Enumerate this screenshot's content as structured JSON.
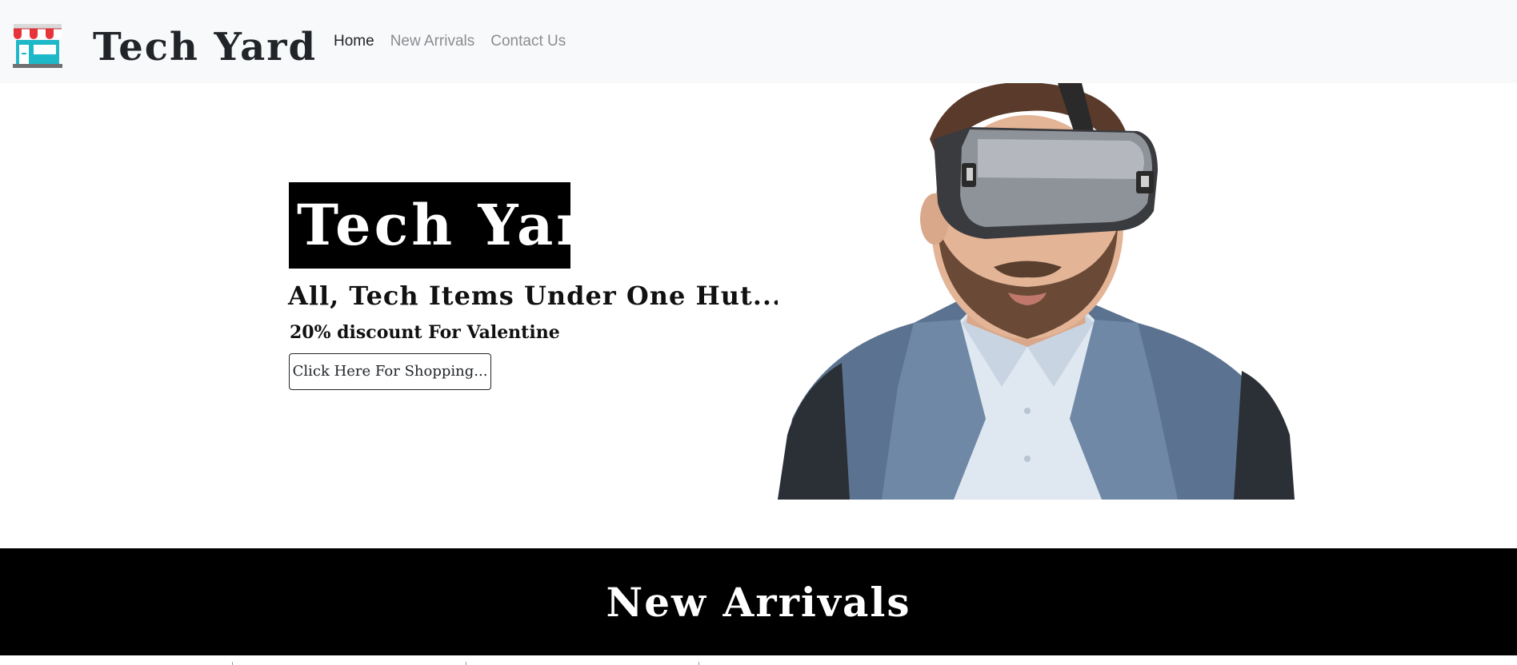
{
  "navbar": {
    "brand_name": "Tech Yard",
    "logo_icon": "storefront-icon",
    "links": [
      {
        "label": "Home",
        "active": true
      },
      {
        "label": "New Arrivals",
        "active": false
      },
      {
        "label": "Contact Us",
        "active": false
      }
    ]
  },
  "hero": {
    "title": "Tech Yard",
    "tagline": "All, Tech Items Under One Hut...",
    "discount": "20% discount For Valentine",
    "button_label": "Click Here For Shopping...",
    "image": "man-wearing-vr-headset-photo"
  },
  "arrivals": {
    "title": "New Arrivals"
  },
  "colors": {
    "navbar_bg": "#f8f9fa",
    "dark": "#000000",
    "text_dark": "#212529",
    "nav_muted": "#8a8d91",
    "logo_awning_red": "#e8333a",
    "logo_body_teal": "#1fb8c8"
  }
}
